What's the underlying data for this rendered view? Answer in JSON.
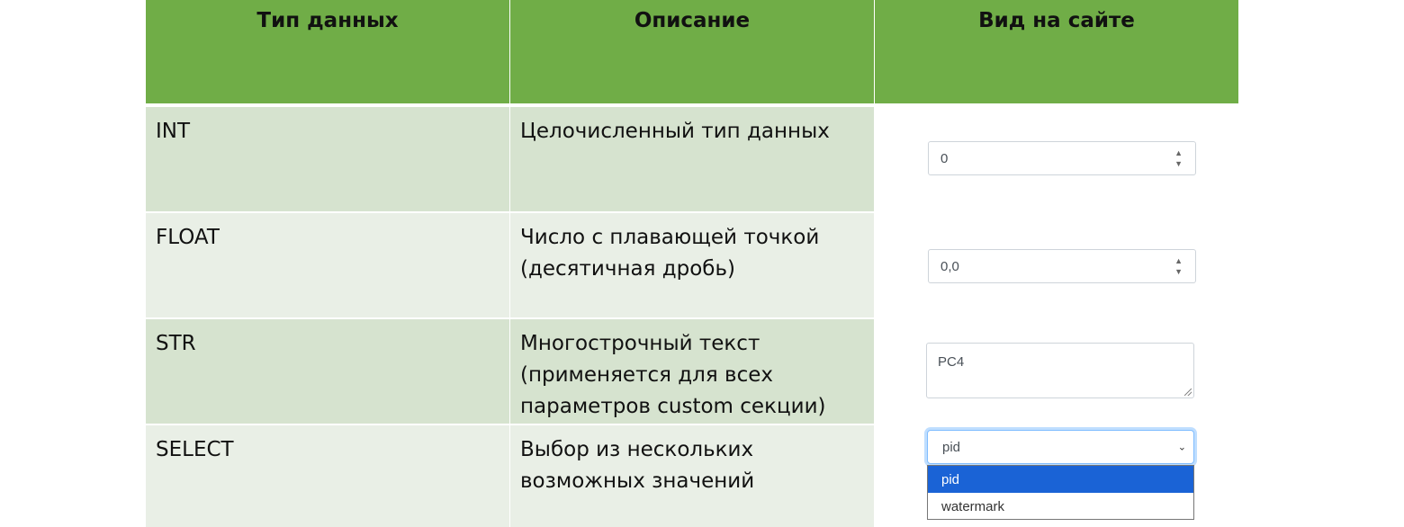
{
  "headers": [
    "Тип данных",
    "Описание",
    "Вид на сайте"
  ],
  "rows": [
    {
      "type": "INT",
      "description": [
        "Целочисленный тип данных"
      ]
    },
    {
      "type": "FLOAT",
      "description": [
        "Число с плавающей точкой",
        "(десятичная дробь)"
      ]
    },
    {
      "type": "STR",
      "description": [
        "Многострочный текст",
        "(применяется для всех",
        "параметров custom секции)"
      ]
    },
    {
      "type": "SELECT",
      "description": [
        "Выбор из нескольких",
        "возможных значений"
      ]
    }
  ],
  "widgets": {
    "int_value": "0",
    "float_value": "0,0",
    "str_value": "PC4",
    "select_value": "pid",
    "select_options": [
      "pid",
      "watermark"
    ]
  },
  "colors": {
    "header": "#70ad47",
    "row_dark": "#d6e3cf",
    "row_light": "#e9efe6",
    "selected_option": "#1a63d6"
  },
  "icons": [
    "spinner-arrows-icon",
    "resize-grip-icon",
    "chevron-down-icon"
  ]
}
